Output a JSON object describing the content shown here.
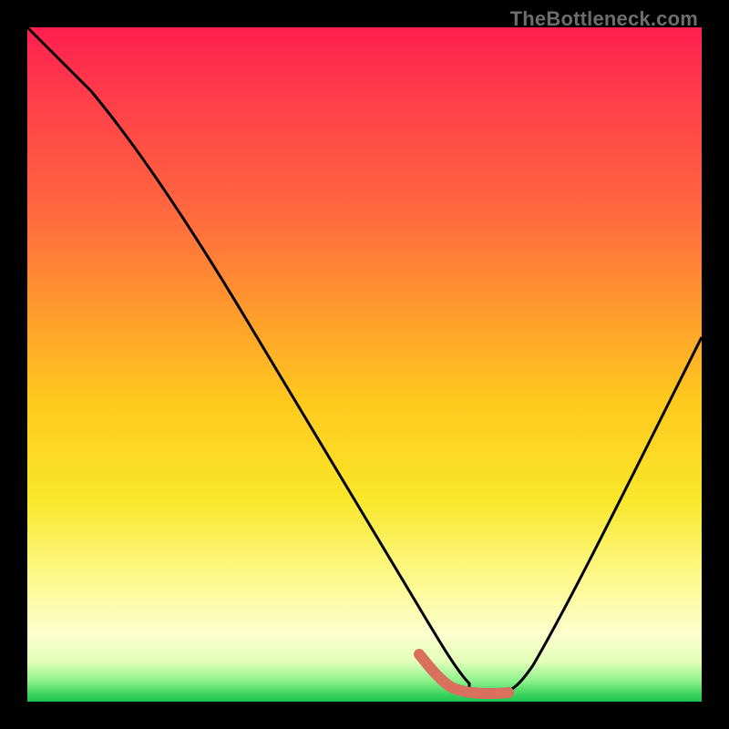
{
  "watermark": "TheBottleneck.com",
  "chart_data": {
    "type": "line",
    "title": "",
    "xlabel": "",
    "ylabel": "",
    "xlim": [
      0,
      100
    ],
    "ylim": [
      0,
      100
    ],
    "grid": false,
    "legend": false,
    "series": [
      {
        "name": "bottleneck-curve",
        "x": [
          0,
          5,
          10,
          15,
          20,
          25,
          30,
          35,
          40,
          45,
          50,
          55,
          58,
          60,
          63,
          66,
          68,
          70,
          75,
          80,
          85,
          90,
          95,
          100
        ],
        "values": [
          100,
          96,
          91,
          84,
          77,
          70,
          62,
          54,
          46,
          38,
          29,
          19,
          12,
          8,
          4,
          2,
          1,
          1,
          4,
          12,
          22,
          34,
          47,
          60
        ]
      }
    ],
    "highlight_range_x": [
      58,
      70
    ],
    "colors": {
      "curve": "#000000",
      "highlight": "#d9705e",
      "gradient_top": "#ff1f4f",
      "gradient_mid1": "#ff9a2d",
      "gradient_mid2": "#f9e72a",
      "gradient_bottom": "#1cc453"
    }
  }
}
